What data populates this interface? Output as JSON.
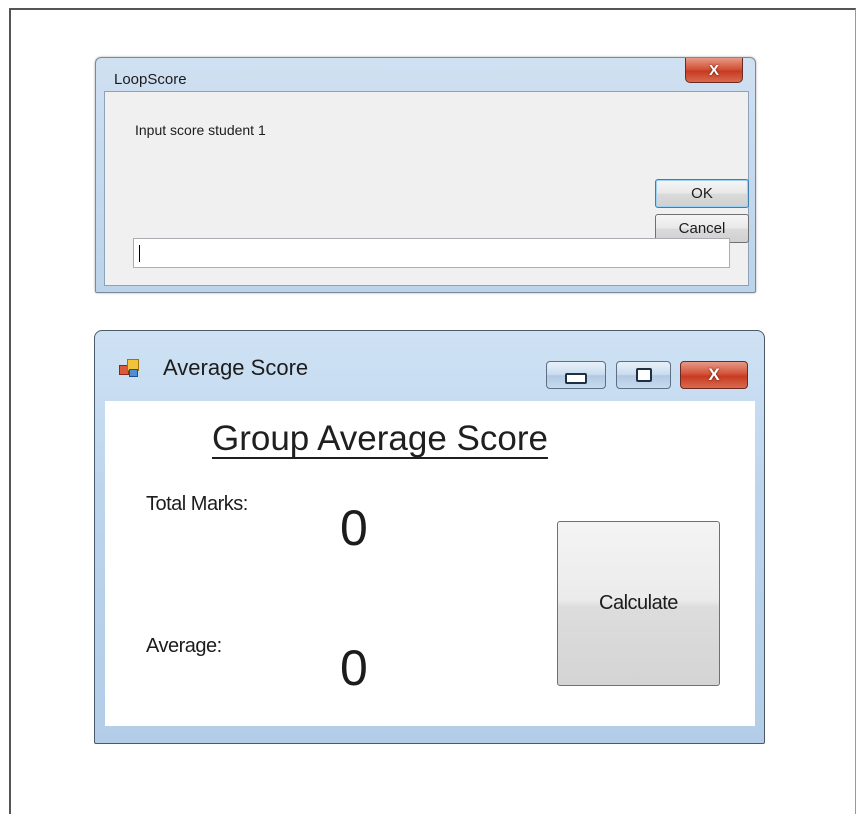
{
  "input_dialog": {
    "title": "LoopScore",
    "close_glyph": "X",
    "prompt": "Input score student 1",
    "ok_label": "OK",
    "cancel_label": "Cancel",
    "input_value": ""
  },
  "main_window": {
    "title": "Average Score",
    "close_glyph": "X",
    "heading": "Group Average Score",
    "total_label": "Total Marks:",
    "total_value": "0",
    "average_label": "Average:",
    "average_value": "0",
    "calculate_label": "Calculate"
  },
  "colors": {
    "close_button_red": "#c63b22",
    "title_bar_blue": "#bcd4ec",
    "ok_focus_border": "#3c7fb1"
  },
  "icons": {
    "dialog_close": "close-icon",
    "app_icon": "form-app-icon",
    "minimize": "minimize-icon",
    "maximize": "maximize-icon",
    "window_close": "close-icon"
  }
}
